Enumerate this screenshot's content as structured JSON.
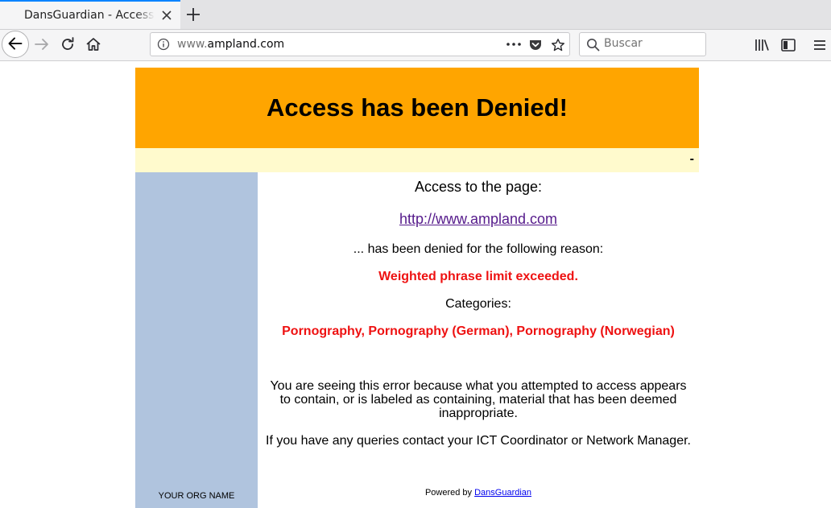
{
  "browser": {
    "tab": {
      "title": "DansGuardian - Access Denied"
    },
    "url": {
      "prefix": "www.",
      "domain": "ampland.com"
    },
    "search": {
      "placeholder": "Buscar"
    }
  },
  "page": {
    "header_title": "Access has been Denied!",
    "strip_text": "-",
    "access_text": "Access to the page:",
    "blocked_url": "http://www.ampland.com",
    "denied_text": "... has been denied for the following reason:",
    "reason": "Weighted phrase limit exceeded.",
    "categories_label": "Categories:",
    "categories": "Pornography, Pornography (German), Pornography (Norwegian)",
    "explanation": "You are seeing this error because what you attempted to access appears to contain, or is labeled as containing, material that has been deemed inappropriate.",
    "contact": "If you have any queries contact your ICT Coordinator or Network Manager.",
    "powered_by_prefix": "Powered by",
    "powered_by_link": "DansGuardian",
    "org_name": "YOUR ORG NAME"
  },
  "colors": {
    "banner": "#ffa500",
    "strip": "#fffacd",
    "sidebar": "#b0c4de",
    "alert": "#ee1111"
  }
}
